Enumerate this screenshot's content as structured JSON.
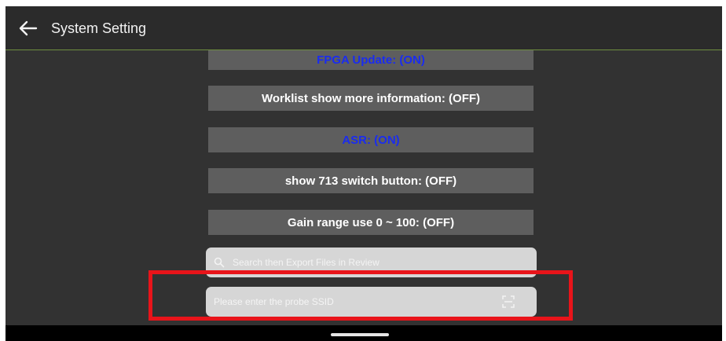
{
  "header": {
    "title": "System Setting",
    "back_icon": "arrow-left-icon"
  },
  "settings": {
    "fpga_update": "FPGA Update: (ON)",
    "worklist_info": "Worklist show more information: (OFF)",
    "asr": "ASR: (ON)",
    "switch_713": "show 713 switch button: (OFF)",
    "gain_range": "Gain range use 0 ~ 100: (OFF)"
  },
  "search": {
    "placeholder": "Search then Export Files in Review",
    "icon": "search-icon"
  },
  "probe_ssid": {
    "placeholder": "Please enter the probe SSID",
    "icon": "scan-icon"
  },
  "colors": {
    "background": "#323232",
    "button": "#5e5e5e",
    "on_text": "#1a2cf0",
    "off_text": "#ffffff",
    "highlight": "#e8141a",
    "header_divider": "#6f8f3f"
  }
}
